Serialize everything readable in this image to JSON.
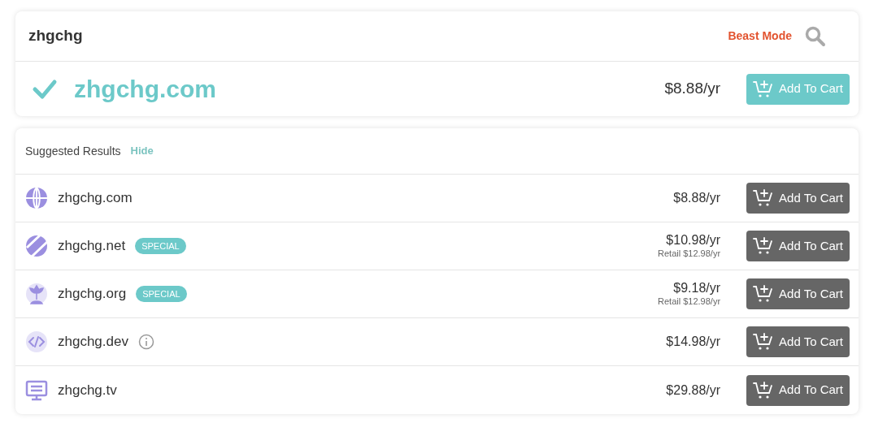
{
  "search": {
    "query": "zhgchg",
    "mode_link": "Beast Mode"
  },
  "match": {
    "available": true,
    "domain": "zhgchg.com",
    "price": "$8.88/yr",
    "button": "Add To Cart"
  },
  "suggested": {
    "title": "Suggested Results",
    "toggle": "Hide",
    "rows": [
      {
        "domain": "zhgchg.com",
        "price": "$8.88/yr",
        "button": "Add To Cart"
      },
      {
        "domain": "zhgchg.net",
        "badge": "SPECIAL",
        "price": "$10.98/yr",
        "retail": "Retail $12.98/yr",
        "button": "Add To Cart"
      },
      {
        "domain": "zhgchg.org",
        "badge": "SPECIAL",
        "price": "$9.18/yr",
        "retail": "Retail $12.98/yr",
        "button": "Add To Cart"
      },
      {
        "domain": "zhgchg.dev",
        "info": true,
        "price": "$14.98/yr",
        "button": "Add To Cart"
      },
      {
        "domain": "zhgchg.tv",
        "price": "$29.88/yr",
        "button": "Add To Cart"
      }
    ]
  }
}
